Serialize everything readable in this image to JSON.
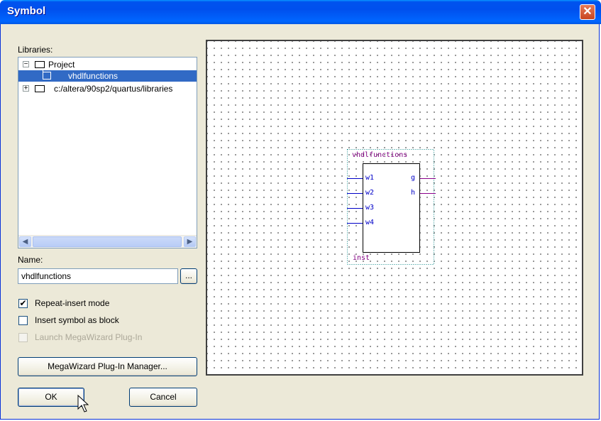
{
  "window": {
    "title": "Symbol",
    "close_glyph": "✕"
  },
  "libraries": {
    "label": "Libraries:",
    "tree": [
      {
        "expander": "−",
        "label": "Project"
      },
      {
        "label": "vhdlfunctions",
        "selected": true
      },
      {
        "expander": "+",
        "label": "c:/altera/90sp2/quartus/libraries"
      }
    ],
    "scroll_left": "◀",
    "scroll_right": "▶"
  },
  "name": {
    "label": "Name:",
    "value": "vhdlfunctions",
    "browse_label": "..."
  },
  "options": {
    "repeat_insert": {
      "label": "Repeat-insert mode",
      "checked": true
    },
    "insert_block": {
      "label": "Insert symbol as block",
      "checked": false
    },
    "megawizard": {
      "label": "Launch MegaWizard Plug-In",
      "disabled": true
    }
  },
  "buttons": {
    "megawizard_manager": "MegaWizard Plug-In Manager...",
    "ok": "OK",
    "cancel": "Cancel"
  },
  "symbol": {
    "name": "vhdlfunctions",
    "instance": "inst",
    "inputs": [
      "w1",
      "w2",
      "w3",
      "w4"
    ],
    "outputs": [
      "g",
      "h"
    ]
  },
  "colors": {
    "title_bar": "#0054e3",
    "selection": "#316ac5",
    "pin_input": "#0000c8",
    "pin_output": "#8b008b",
    "symbol_text": "#800080"
  }
}
